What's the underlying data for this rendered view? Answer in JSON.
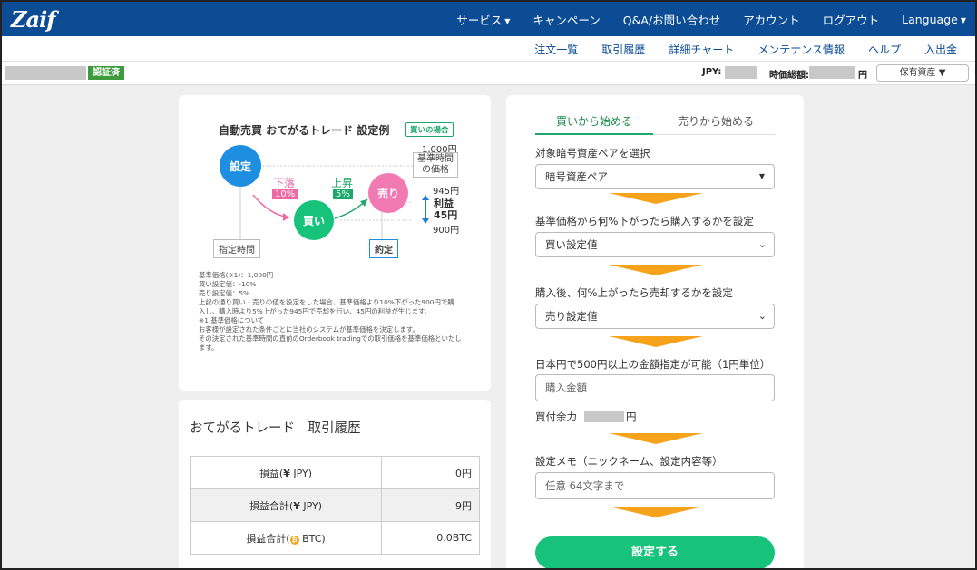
{
  "navbar": {
    "logo": "Zaif",
    "items": [
      {
        "label": "サービス",
        "caret": "▼"
      },
      {
        "label": "キャンペーン"
      },
      {
        "label": "Q&A/お問い合わせ"
      },
      {
        "label": "アカウント"
      },
      {
        "label": "ログアウト"
      },
      {
        "label": "Language",
        "caret": "▼"
      }
    ]
  },
  "subnav": {
    "items": [
      "注文一覧",
      "取引履歴",
      "詳細チャート",
      "メンテナンス情報",
      "ヘルプ",
      "入出金"
    ]
  },
  "account": {
    "verified": "認証済",
    "jpy_label": "JPY:",
    "total_label": "時価総額:",
    "total_unit": "円",
    "assets_button": "保有資産 ▼"
  },
  "diagram": {
    "title": "自動売買 おてがるトレード 設定例",
    "tag": "買いの場合",
    "set": "設定",
    "buy": "買い",
    "sell": "売り",
    "drop_label": "下落",
    "drop_pct": "10%",
    "rise_label": "上昇",
    "rise_pct": "5%",
    "price_1000": "1,000円",
    "base_time_price_1": "基準時間",
    "base_time_price_2": "の価格",
    "price_945": "945円",
    "profit_label": "利益",
    "profit_value": "45円",
    "price_900": "900円",
    "specified_time": "指定時間",
    "contract": "約定",
    "notes": [
      "基準価格(※1)：1,000円",
      "買い設定値：-10%",
      "売り設定値：5%",
      "上記の通り買い・売りの値を設定をした場合、基準価格より10%下がった900円で購",
      "入し、購入時より5%上がった945円で売却を行い、45円の利益が生じます。",
      "※1 基準価格について",
      "お客様が設定された条件ごとに当社のシステムが基準価格を決定します。",
      "その決定された基準時間の直前のOrderbook tradingでの取引価格を基準価格といたし",
      "ます。"
    ]
  },
  "history": {
    "title": "おてがるトレード　取引履歴",
    "rows": [
      {
        "label_pre": "損益(",
        "currency_icon": "¥",
        "label_post": " JPY)",
        "value": "0円"
      },
      {
        "label_pre": "損益合計(",
        "currency_icon": "¥",
        "label_post": " JPY)",
        "value": "9円"
      },
      {
        "label_pre": "損益合計(",
        "currency_icon": "₿",
        "label_post": " BTC)",
        "value": "0.0BTC"
      }
    ]
  },
  "form": {
    "tab_buy": "買いから始める",
    "tab_sell": "売りから始める",
    "pair_label": "対象暗号資産ペアを選択",
    "pair_value": "暗号資産ペア",
    "buy_label": "基準価格から何%下がったら購入するかを設定",
    "buy_value": "買い設定値",
    "sell_label": "購入後、何%上がったら売却するかを設定",
    "sell_value": "売り設定値",
    "amount_label": "日本円で500円以上の金額指定が可能（1円単位）",
    "amount_placeholder": "購入金額",
    "available_label": "買付余力",
    "available_unit": "円",
    "memo_label": "設定メモ（ニックネーム、設定内容等）",
    "memo_placeholder": "任意 64文字まで",
    "submit": "設定する"
  }
}
